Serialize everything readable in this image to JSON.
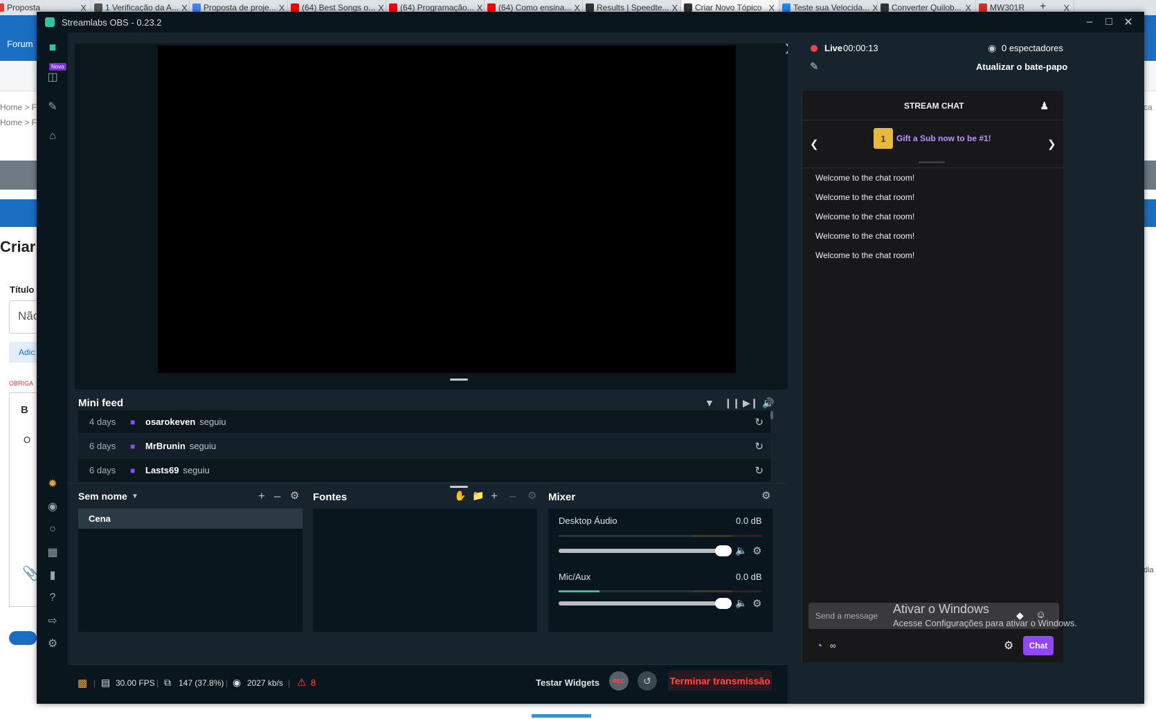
{
  "browser_tabs": [
    {
      "label": "Proposta",
      "icon": "page-icon",
      "color": "#e53935",
      "close": "X"
    },
    {
      "label": "1 Verificação da A...",
      "icon": "page-icon",
      "color": "#555555",
      "close": "X"
    },
    {
      "label": "Proposta de proje...",
      "icon": "docs-icon",
      "color": "#4285f4",
      "close": "X"
    },
    {
      "label": "(64) Best Songs o...",
      "icon": "youtube-icon",
      "color": "#ff0000",
      "close": "X"
    },
    {
      "label": "(64) Programação...",
      "icon": "youtube-icon",
      "color": "#ff0000",
      "close": "X"
    },
    {
      "label": "(64) Como ensina...",
      "icon": "youtube-icon",
      "color": "#ff0000",
      "close": "X"
    },
    {
      "label": "Results | Speedte...",
      "icon": "speedtest-icon",
      "color": "#333333",
      "close": "X"
    },
    {
      "label": "Criar Novo Tópico",
      "icon": "forum-icon",
      "color": "#333333",
      "close": "X"
    },
    {
      "label": "Teste sua Velocida...",
      "icon": "globe-icon",
      "color": "#1e88e5",
      "close": "X"
    },
    {
      "label": "Converter Quilob...",
      "icon": "converter-icon",
      "color": "#333333",
      "close": "X"
    },
    {
      "label": "MW301R",
      "icon": "gmail-icon",
      "color": "#d93025",
      "close": "X"
    }
  ],
  "browser_newtab": "+",
  "bg_page": {
    "forum_link": "Forum",
    "breadcrumb": "Home > F",
    "breadcrumb_right": "rca",
    "heading": "Criar",
    "title_label": "Título",
    "title_value": "Não",
    "add_button": "Adic",
    "required": "OBRIGA",
    "bold": "B",
    "body_text": "O",
    "side_text": "dia"
  },
  "obs": {
    "title": "Streamlabs OBS - 0.23.2",
    "nav_badge": "Novo",
    "minifeed": {
      "title": "Mini feed",
      "rows": [
        {
          "ago": "4 days",
          "name": "osarokeven",
          "action": "seguiu"
        },
        {
          "ago": "6 days",
          "name": "MrBrunin",
          "action": "seguiu"
        },
        {
          "ago": "6 days",
          "name": "Lasts69",
          "action": "seguiu"
        }
      ]
    },
    "scenes": {
      "title": "Sem nome",
      "items": [
        "Cena"
      ]
    },
    "sources": {
      "title": "Fontes"
    },
    "mixer": {
      "title": "Mixer",
      "channels": [
        {
          "name": "Desktop Áudio",
          "db": "0.0 dB",
          "level": 0.0
        },
        {
          "name": "Mic/Aux",
          "db": "0.0 dB",
          "level": 0.2
        }
      ]
    },
    "status": {
      "fps": "30.00 FPS",
      "dropped": "147 (37.8%)",
      "bitrate": "2027 kb/s",
      "warnings": "8",
      "test_widgets": "Testar Widgets",
      "rec": "REC",
      "end_stream": "Terminar transmissão"
    },
    "live": {
      "label": "Live",
      "time": "00:00:13",
      "viewers": "0 espectadores",
      "refresh_chat": "Atualizar o bate-papo"
    },
    "chat": {
      "title": "STREAM CHAT",
      "gift_text": "Gift a Sub now to be #1!",
      "gift_rank": "1",
      "messages": [
        "Welcome to the chat room!",
        "Welcome to the chat room!",
        "Welcome to the chat room!",
        "Welcome to the chat room!",
        "Welcome to the chat room!"
      ],
      "placeholder": "Send a message",
      "points": "∞",
      "send_label": "Chat"
    }
  },
  "watermark": {
    "line1": "Ativar o Windows",
    "line2": "Acesse Configurações para ativar o Windows."
  },
  "colors": {
    "accent_teal": "#31c3a2",
    "twitch_purple": "#9146ff",
    "live_red": "#f0444a",
    "end_stream_red": "#ff4b4b"
  }
}
